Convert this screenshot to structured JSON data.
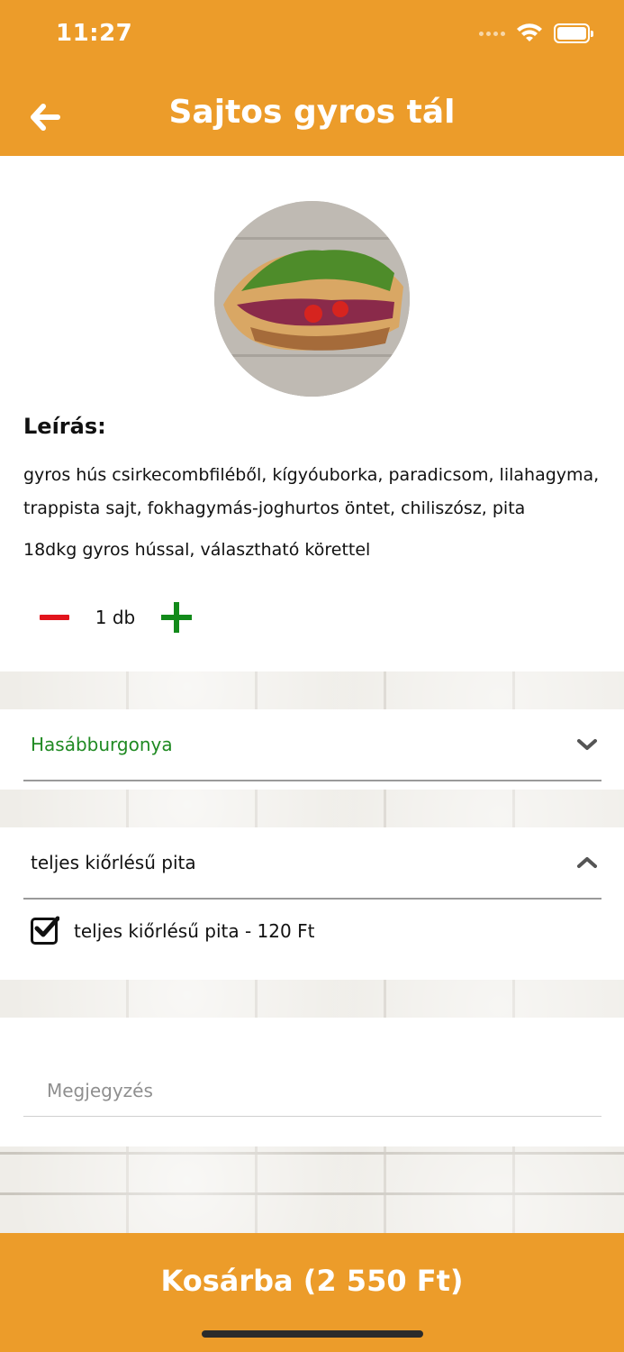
{
  "status_bar": {
    "time": "11:27"
  },
  "header": {
    "title": "Sajtos gyros tál"
  },
  "product": {
    "description_heading": "Leírás:",
    "description": "gyros hús csirkecombfiléből, kígyóuborka, paradicsom, lilahagyma, trappista sajt, fokhagymás-joghurtos öntet, chiliszósz, pita",
    "description_extra": "18dkg gyros hússal, választható körettel",
    "quantity": "1 db"
  },
  "options": {
    "side_dish": {
      "selected": "Hasábburgonya"
    },
    "bread": {
      "selected": "teljes kiőrlésű pita",
      "items": [
        {
          "label": "teljes kiőrlésű pita - 120 Ft",
          "checked": true
        }
      ]
    }
  },
  "note": {
    "placeholder": "Megjegyzés"
  },
  "cart": {
    "label": "Kosárba (2 550 Ft)"
  },
  "colors": {
    "brand": "#ec9c2a",
    "minus": "#e2141c",
    "plus": "#128a1a",
    "selected_text": "#1f8a22"
  },
  "icons": [
    "back-arrow-icon",
    "wifi-icon",
    "battery-icon",
    "minus-icon",
    "plus-icon",
    "chevron-down-icon",
    "chevron-up-icon",
    "checkbox-checked-icon"
  ]
}
